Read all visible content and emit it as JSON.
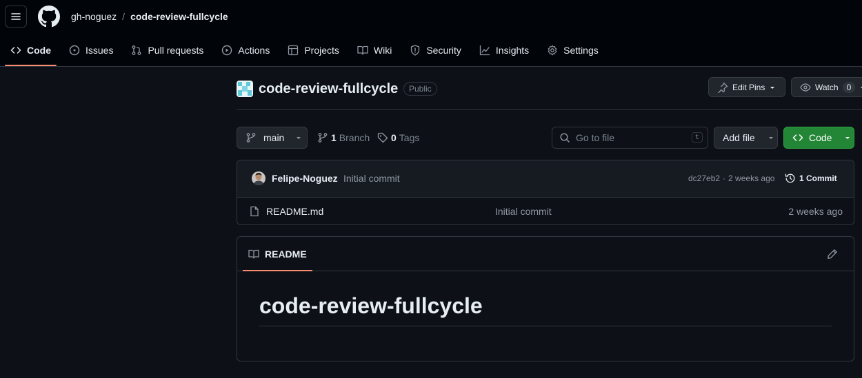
{
  "header": {
    "owner": "gh-noguez",
    "separator": "/",
    "repo": "code-review-fullcycle"
  },
  "nav": {
    "tabs": [
      {
        "label": "Code",
        "icon": "code-icon",
        "active": true
      },
      {
        "label": "Issues",
        "icon": "issue-icon"
      },
      {
        "label": "Pull requests",
        "icon": "pull-request-icon"
      },
      {
        "label": "Actions",
        "icon": "play-icon"
      },
      {
        "label": "Projects",
        "icon": "table-icon"
      },
      {
        "label": "Wiki",
        "icon": "book-icon"
      },
      {
        "label": "Security",
        "icon": "shield-icon"
      },
      {
        "label": "Insights",
        "icon": "graph-icon"
      },
      {
        "label": "Settings",
        "icon": "gear-icon"
      }
    ]
  },
  "repo": {
    "title": "code-review-fullcycle",
    "visibility": "Public",
    "edit_pins_label": "Edit Pins",
    "watch_label": "Watch",
    "watch_count": "0"
  },
  "branchbar": {
    "branch": "main",
    "branch_count": "1",
    "branch_label": "Branch",
    "tag_count": "0",
    "tag_label": "Tags",
    "search_placeholder": "Go to file",
    "search_shortcut": "t",
    "add_file_label": "Add file",
    "code_label": "Code"
  },
  "commit": {
    "author": "Felipe-Noguez",
    "message": "Initial commit",
    "hash": "dc27eb2",
    "dot": "·",
    "age": "2 weeks ago",
    "commits_label": "1 Commit"
  },
  "files": [
    {
      "name": "README.md",
      "message": "Initial commit",
      "age": "2 weeks ago"
    }
  ],
  "readme": {
    "tab_label": "README",
    "heading": "code-review-fullcycle"
  },
  "colors": {
    "accent_underline": "#fd8c73",
    "primary_button": "#238636"
  }
}
